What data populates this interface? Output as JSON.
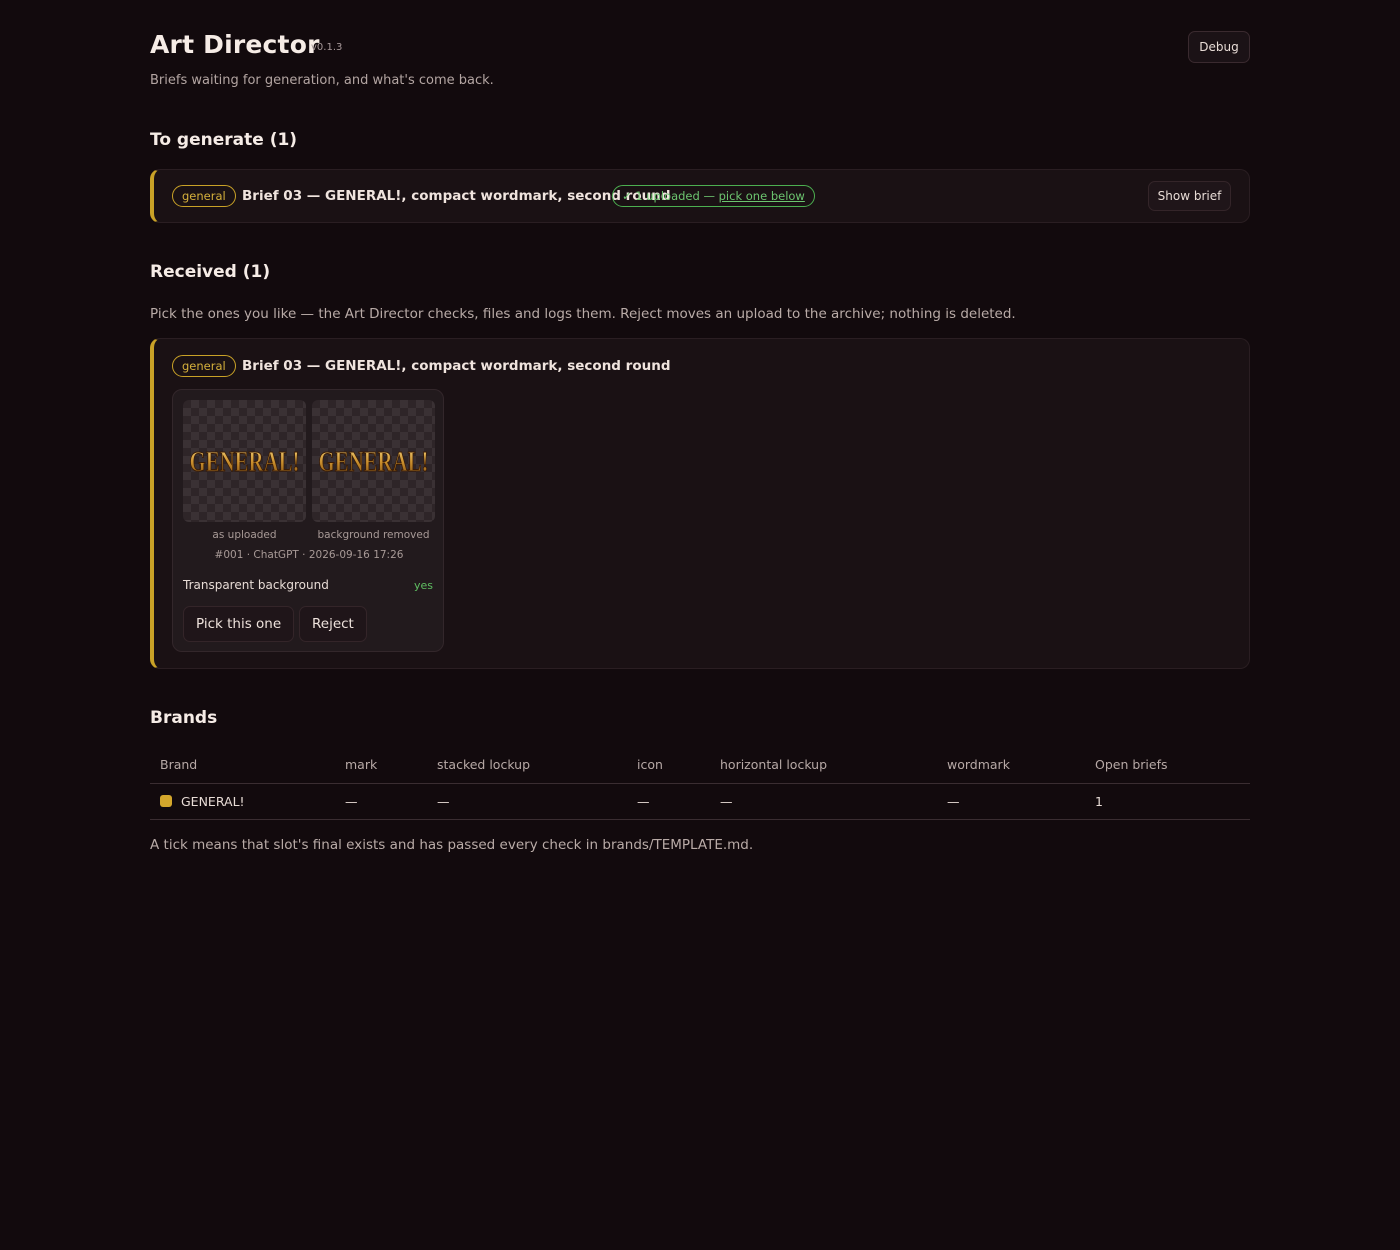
{
  "header": {
    "title": "Art Director",
    "version": "v0.1.3",
    "subtitle": "Briefs waiting for generation, and what's come back.",
    "debug_label": "Debug"
  },
  "to_generate": {
    "heading": "To generate (1)",
    "items": [
      {
        "tag": "general",
        "title": "Brief 03 — GENERAL!, compact wordmark, second round",
        "status_prefix": "✓ 1 uploaded — ",
        "status_link": "pick one below",
        "show_brief_label": "Show brief"
      }
    ]
  },
  "received": {
    "heading": "Received (1)",
    "help": "Pick the ones you like — the Art Director checks, files and logs them. Reject moves an upload to the archive; nothing is deleted.",
    "items": [
      {
        "tag": "general",
        "title": "Brief 03 — GENERAL!, compact wordmark, second round",
        "uploads": [
          {
            "logo_text": "GENERAL!",
            "caption_uploaded": "as uploaded",
            "caption_removed": "background removed",
            "meta": "#001 · ChatGPT · 2026-09-16 17:26",
            "check_label": "Transparent background",
            "check_value": "yes",
            "pick_label": "Pick this one",
            "reject_label": "Reject"
          }
        ]
      }
    ]
  },
  "brands": {
    "heading": "Brands",
    "columns": [
      "Brand",
      "mark",
      "stacked lockup",
      "icon",
      "horizontal lockup",
      "wordmark",
      "Open briefs"
    ],
    "rows": [
      {
        "name": "GENERAL!",
        "color": "#d4a72c",
        "cells": [
          "—",
          "—",
          "—",
          "—",
          "—"
        ],
        "open_briefs": "1"
      }
    ],
    "footnote": "A tick means that slot's final exists and has passed every check in brands/TEMPLATE.md."
  },
  "colors": {
    "background": "#120a0d",
    "accent": "#c9a227",
    "success": "#5fbf62"
  }
}
